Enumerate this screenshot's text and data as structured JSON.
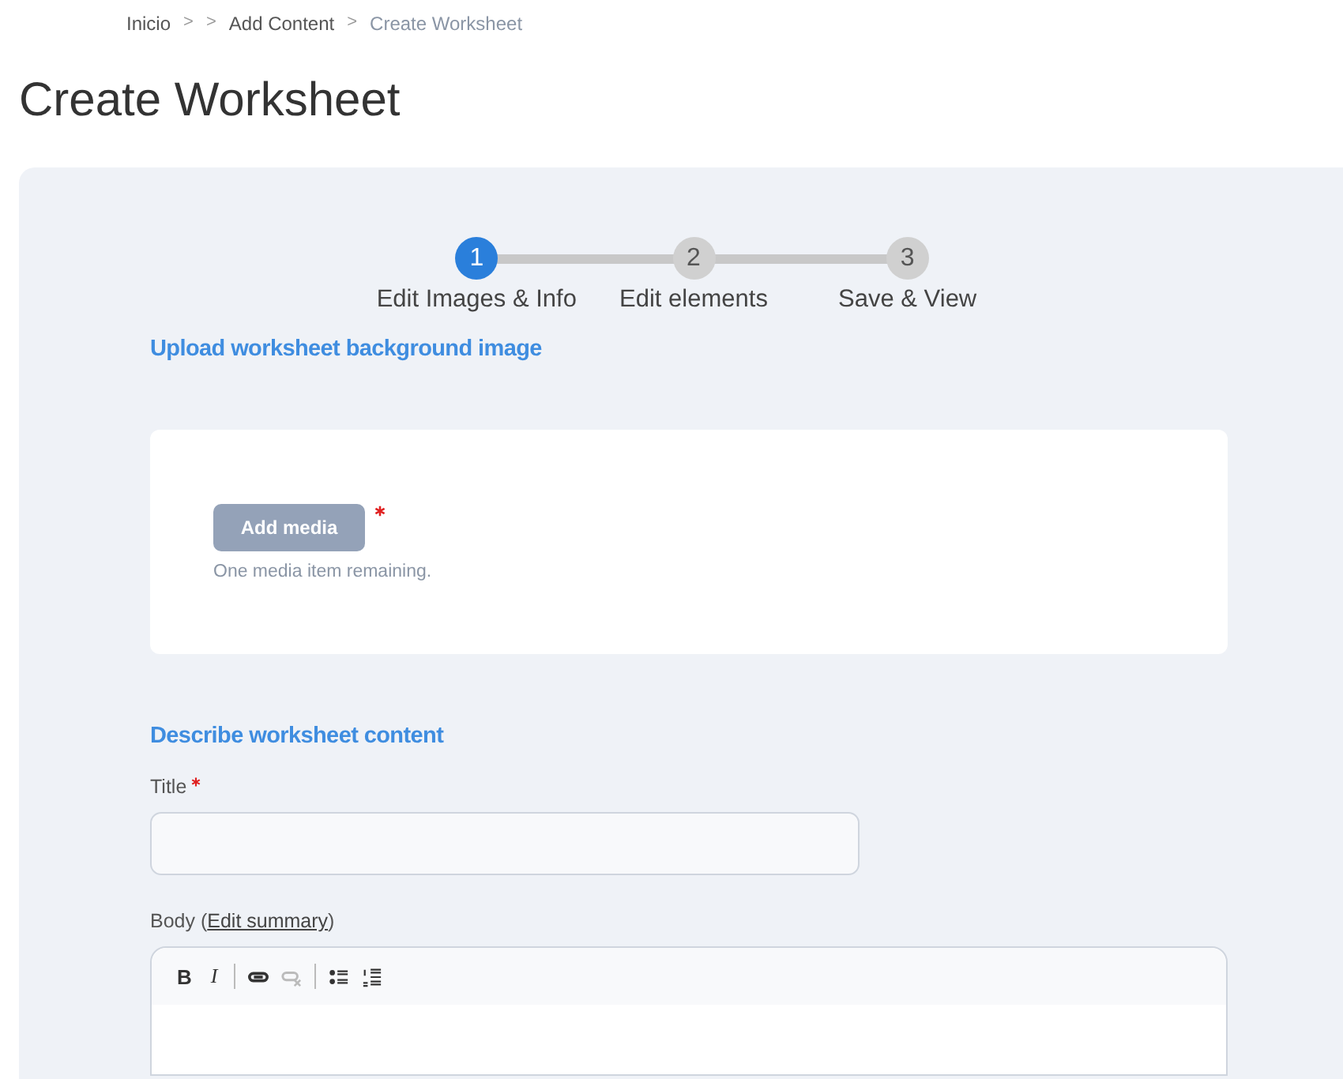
{
  "breadcrumb": [
    {
      "kind": "link",
      "text": "Inicio"
    },
    {
      "kind": "separator",
      "text": ">"
    },
    {
      "kind": "separator",
      "text": ">"
    },
    {
      "kind": "link",
      "text": "Add Content"
    },
    {
      "kind": "separator",
      "text": ">"
    },
    {
      "kind": "current",
      "text": "Create Worksheet"
    }
  ],
  "page_title": "Create Worksheet",
  "steps": [
    {
      "number": "1",
      "label": "Edit Images & Info",
      "selected": true
    },
    {
      "number": "2",
      "label": "Edit elements",
      "selected": false
    },
    {
      "number": "3",
      "label": "Save & View",
      "selected": false
    }
  ],
  "upload": {
    "heading": "Upload worksheet background image",
    "button": "Add media",
    "required": true,
    "hint": "One media item remaining."
  },
  "describe": {
    "heading": "Describe worksheet content",
    "title_field": {
      "label": "Title",
      "required": true
    },
    "body": {
      "label": "Body (",
      "link": "Edit summary",
      "label_end": ")",
      "toolbar": [
        {
          "kind": "bold",
          "text": "B",
          "disabled": false
        },
        {
          "kind": "italic",
          "text": "I",
          "disabled": false
        },
        {
          "kind": "separator"
        },
        {
          "kind": "link",
          "disabled": false
        },
        {
          "kind": "unlink",
          "disabled": true
        },
        {
          "kind": "separator"
        },
        {
          "kind": "bullets",
          "disabled": false
        },
        {
          "kind": "numbers",
          "disabled": false
        }
      ]
    }
  }
}
